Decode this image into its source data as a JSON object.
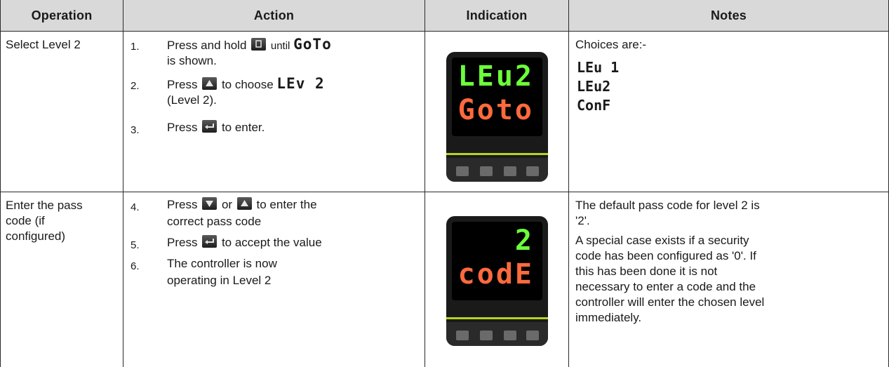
{
  "table": {
    "headers": [
      "Operation",
      "Action",
      "Indication",
      "Notes"
    ],
    "row1": {
      "operation": "Select Level 2",
      "steps": [
        {
          "num": "1.",
          "pre": "Press and hold",
          "mid": "until",
          "seg": "GoTo",
          "post": "is shown."
        },
        {
          "num": "2.",
          "pre": "Press",
          "mid": "to choose",
          "seg": "LEv 2",
          "post": "(Level 2)."
        },
        {
          "num": "3.",
          "pre": "Press",
          "post": "to enter."
        }
      ],
      "display_top": "LEu2",
      "display_bottom": "Goto",
      "notes_title": "Choices are:-",
      "choices": [
        "LEu 1",
        "LEu2",
        "ConF"
      ]
    },
    "row2": {
      "operation_lines": [
        "Enter the pass",
        "code (if",
        "configured)"
      ],
      "steps": [
        {
          "num": "4.",
          "pre": "Press",
          "mid": "or",
          "post": "to enter the",
          "line2": "correct pass code"
        },
        {
          "num": "5.",
          "pre": "Press",
          "post": "to accept the value"
        },
        {
          "num": "6.",
          "pre": "The controller is now",
          "line2": "operating in Level 2"
        }
      ],
      "display_top": "2",
      "display_bottom": "codE",
      "notes": [
        "The default pass code for level 2 is",
        "'2'.",
        "A special case exists if a security",
        "code has been configured as '0'.  If",
        "this has been done it is not",
        "necessary to enter a code and the",
        "controller will enter the chosen level",
        "immediately."
      ]
    }
  },
  "colors": {
    "header_bg": "#d9d9d9",
    "lcd_green": "#6cff3a",
    "lcd_red": "#ff6a3d",
    "device_accent": "#b5d41e"
  },
  "icons": [
    "page-key-icon",
    "up-arrow-key-icon",
    "down-arrow-key-icon",
    "enter-key-icon"
  ]
}
